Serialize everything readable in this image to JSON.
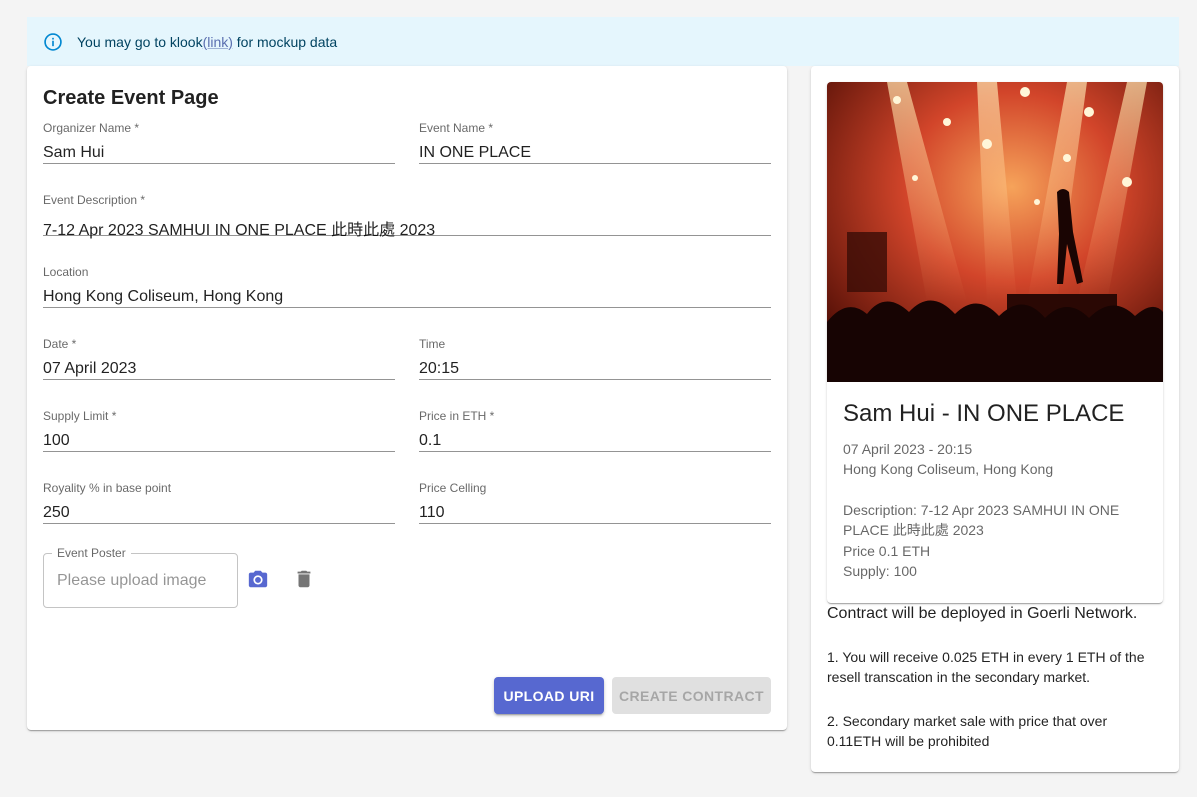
{
  "alert": {
    "prefix": "You may go to klook",
    "link_text": "(link)",
    "suffix": " for mockup data"
  },
  "form": {
    "title": "Create Event Page",
    "organizer": {
      "label": "Organizer Name *",
      "value": "Sam Hui"
    },
    "event_name": {
      "label": "Event Name *",
      "value": "IN ONE PLACE"
    },
    "description": {
      "label": "Event Description *",
      "value": "7-12 Apr 2023 SAMHUI IN ONE PLACE 此時此處 2023"
    },
    "location": {
      "label": "Location",
      "value": "Hong Kong Coliseum, Hong Kong"
    },
    "date": {
      "label": "Date *",
      "value": "07 April 2023"
    },
    "time": {
      "label": "Time",
      "value": "20:15"
    },
    "supply": {
      "label": "Supply Limit *",
      "value": "100"
    },
    "price": {
      "label": "Price in ETH *",
      "value": "0.1"
    },
    "royalty": {
      "label": "Royality % in base point",
      "value": "250"
    },
    "ceiling": {
      "label": "Price Celling",
      "value": "110"
    },
    "poster": {
      "label": "Event Poster",
      "placeholder": "Please upload image"
    },
    "icons": {
      "camera": "camera-icon",
      "delete": "trash-icon"
    },
    "upload_button": "UPLOAD URI",
    "create_button": "CREATE CONTRACT"
  },
  "preview": {
    "title": "Sam Hui - IN ONE PLACE",
    "datetime": "07 April 2023 - 20:15",
    "location": "Hong Kong Coliseum, Hong Kong",
    "description": "Description: 7-12 Apr 2023 SAMHUI IN ONE PLACE 此時此處 2023",
    "price": "Price 0.1 ETH",
    "supply": "Supply: 100"
  },
  "contract": {
    "title": "Contract will be deployed in Goerli Network.",
    "point1": "1. You will receive 0.025 ETH in every 1 ETH of the resell transcation in the secondary market.",
    "point2": "2. Secondary market sale with price that over 0.11ETH will be prohibited"
  },
  "colors": {
    "primary": "#5768d0",
    "alert_bg": "#e5f6fd",
    "alert_text": "#014361"
  }
}
